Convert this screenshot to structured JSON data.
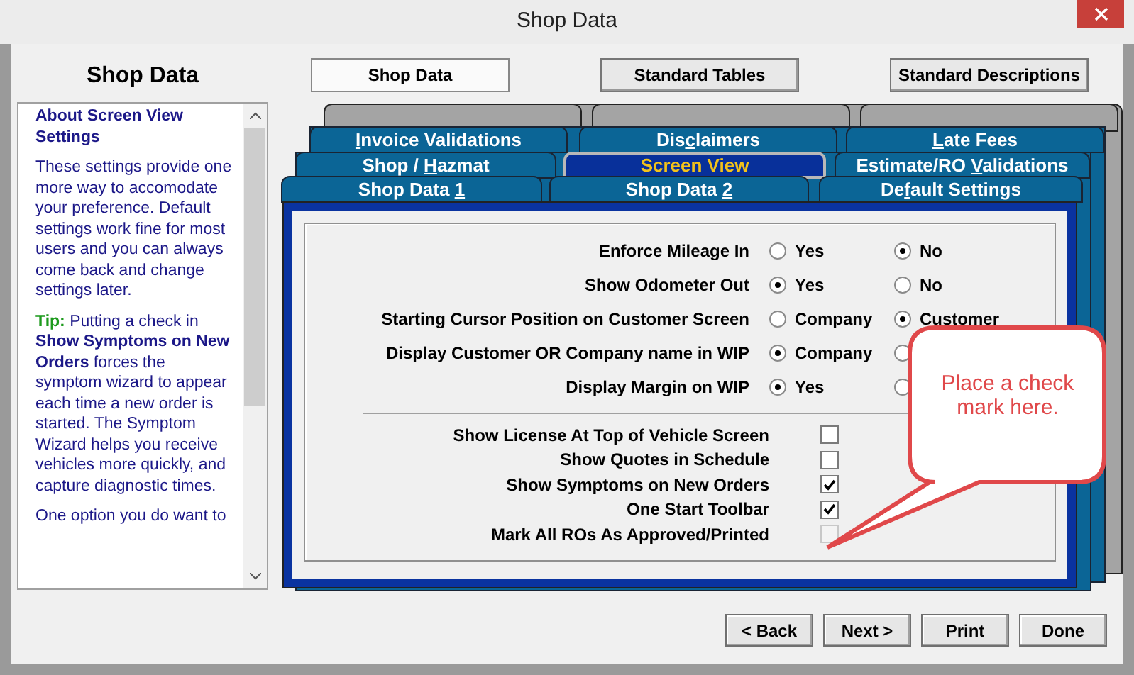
{
  "window": {
    "title": "Shop Data"
  },
  "heading": "Shop Data",
  "help": {
    "title": "About Screen View Settings",
    "paragraphs": [
      {
        "kind": "text",
        "text": "These settings provide one more way to accomodate your preference. Default settings work fine for most users and you can always come back and change settings later."
      },
      {
        "kind": "tip",
        "label": "Tip:",
        "text": "Putting a check in **Show Symptoms on New Orders** forces the symptom wizard to appear each time a new order is started. The Symptom Wizard helps you receive vehicles more quickly, and capture diagnostic times."
      },
      {
        "kind": "text",
        "text": "One option you do want to"
      }
    ]
  },
  "top_buttons": [
    {
      "label": "Shop Data",
      "selected": true
    },
    {
      "label": "Standard Tables",
      "selected": false
    },
    {
      "label": "Standard Descriptions",
      "selected": false
    }
  ],
  "tab_rows": [
    [
      {
        "key": "I",
        "post": "nvoice Validations",
        "selected": false
      },
      {
        "pre": "Dis",
        "key": "c",
        "post": "laimers",
        "selected": false
      },
      {
        "key": "L",
        "post": "ate Fees",
        "selected": false
      }
    ],
    [
      {
        "pre": "Shop / ",
        "key": "H",
        "post": "azmat",
        "selected": false
      },
      {
        "pre": "Screen View",
        "selected": true
      },
      {
        "pre": "Estimate/RO ",
        "key": "V",
        "post": "alidations",
        "selected": false
      }
    ],
    [
      {
        "pre": "Shop Data ",
        "key": "1",
        "selected": false
      },
      {
        "pre": "Shop Data ",
        "key": "2",
        "selected": false
      },
      {
        "pre": "De",
        "key": "f",
        "post": "ault Settings",
        "selected": false
      }
    ]
  ],
  "radio_settings": [
    {
      "label": "Enforce Mileage In",
      "options": [
        {
          "label": "Yes",
          "selected": false
        },
        {
          "label": "No",
          "selected": true
        }
      ]
    },
    {
      "label": "Show Odometer Out",
      "options": [
        {
          "label": "Yes",
          "selected": true
        },
        {
          "label": "No",
          "selected": false
        }
      ]
    },
    {
      "label": "Starting Cursor Position on Customer Screen",
      "options": [
        {
          "label": "Company",
          "selected": false
        },
        {
          "label": "Customer",
          "selected": true
        }
      ]
    },
    {
      "label": "Display Customer OR Company name in WIP",
      "options": [
        {
          "label": "Company",
          "selected": true
        },
        {
          "selected": false
        }
      ]
    },
    {
      "label": "Display Margin on WIP",
      "options": [
        {
          "label": "Yes",
          "selected": true
        },
        {
          "selected": false
        }
      ]
    }
  ],
  "checkbox_settings": [
    {
      "label": "Show License At Top of Vehicle Screen",
      "checked": false,
      "disabled": false
    },
    {
      "label": "Show Quotes in Schedule",
      "checked": false,
      "disabled": false
    },
    {
      "label": "Show Symptoms on New Orders",
      "checked": true,
      "disabled": false
    },
    {
      "label": "One Start Toolbar",
      "checked": true,
      "disabled": false
    },
    {
      "label": "Mark All ROs As Approved/Printed",
      "checked": false,
      "disabled": true
    }
  ],
  "callout": {
    "text": "Place a check mark here."
  },
  "bottom_buttons": [
    {
      "label": "< Back"
    },
    {
      "label": "Next >"
    },
    {
      "label": "Print"
    },
    {
      "label": "Done"
    }
  ]
}
